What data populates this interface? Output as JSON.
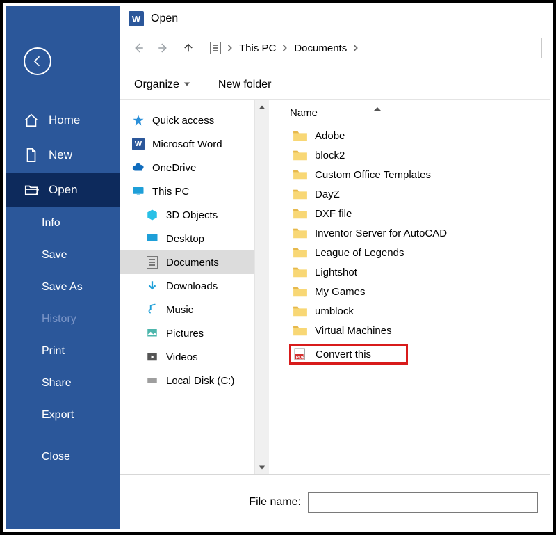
{
  "backstage": {
    "home": "Home",
    "new": "New",
    "open": "Open",
    "info": "Info",
    "save": "Save",
    "saveas": "Save As",
    "history": "History",
    "print": "Print",
    "share": "Share",
    "export": "Export",
    "close": "Close"
  },
  "dialog": {
    "title": "Open",
    "breadcrumb": {
      "thispc": "This PC",
      "folder": "Documents"
    },
    "toolbar": {
      "organize": "Organize",
      "newfolder": "New folder"
    },
    "columns": {
      "name": "Name"
    },
    "filename_label": "File name:",
    "filename_value": ""
  },
  "navtree": {
    "quickaccess": "Quick access",
    "msword": "Microsoft Word",
    "onedrive": "OneDrive",
    "thispc": "This PC",
    "objects3d": "3D Objects",
    "desktop": "Desktop",
    "documents": "Documents",
    "downloads": "Downloads",
    "music": "Music",
    "pictures": "Pictures",
    "videos": "Videos",
    "localdisk": "Local Disk (C:)"
  },
  "files": [
    {
      "name": "Adobe",
      "type": "folder"
    },
    {
      "name": "block2",
      "type": "folder"
    },
    {
      "name": "Custom Office Templates",
      "type": "folder"
    },
    {
      "name": "DayZ",
      "type": "folder"
    },
    {
      "name": "DXF file",
      "type": "folder"
    },
    {
      "name": "Inventor Server for AutoCAD",
      "type": "folder"
    },
    {
      "name": "League of Legends",
      "type": "folder"
    },
    {
      "name": "Lightshot",
      "type": "folder"
    },
    {
      "name": "My Games",
      "type": "folder"
    },
    {
      "name": "umblock",
      "type": "folder"
    },
    {
      "name": "Virtual Machines",
      "type": "folder"
    },
    {
      "name": "Convert this",
      "type": "pdf",
      "highlight": true
    }
  ]
}
